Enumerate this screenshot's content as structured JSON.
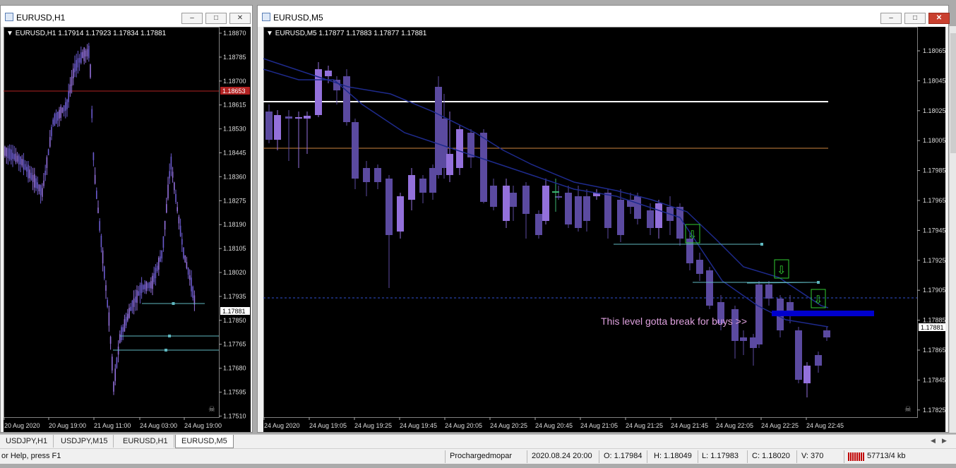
{
  "left_window": {
    "title": "EURUSD,H1",
    "info": "EURUSD,H1  1.17914 1.17923 1.17834 1.17881",
    "price_labels": [
      "1.18870",
      "1.18785",
      "1.18700",
      "1.18615",
      "1.18530",
      "1.18445",
      "1.18360",
      "1.18275",
      "1.18190",
      "1.18105",
      "1.18020",
      "1.17935",
      "1.17850",
      "1.17765",
      "1.17680",
      "1.17595",
      "1.17510"
    ],
    "red_line_label": "1.18653",
    "current_price_label": "1.17881",
    "time_labels": [
      "20 Aug 2020",
      "20 Aug 19:00",
      "21 Aug 11:00",
      "24 Aug 03:00",
      "24 Aug 19:00"
    ],
    "colors": {
      "bull": "#9370db",
      "bear": "#6a5acd",
      "red_line": "#b22222",
      "trend": "#5fb8c0"
    }
  },
  "right_window": {
    "title": "EURUSD,M5",
    "info": "EURUSD,M5  1.17877 1.17883 1.17877 1.17881",
    "price_labels": [
      "1.18065",
      "1.18045",
      "1.18025",
      "1.18005",
      "1.17985",
      "1.17965",
      "1.17945",
      "1.17925",
      "1.17905",
      "1.17885",
      "1.17865",
      "1.17845",
      "1.17825"
    ],
    "current_price_label": "1.17881",
    "time_labels": [
      "24 Aug 2020",
      "24 Aug 19:05",
      "24 Aug 19:25",
      "24 Aug 19:45",
      "24 Aug 20:05",
      "24 Aug 20:25",
      "24 Aug 20:45",
      "24 Aug 21:05",
      "24 Aug 21:25",
      "24 Aug 21:45",
      "24 Aug 22:05",
      "24 Aug 22:25",
      "24 Aug 22:45"
    ],
    "annotation": "This level gotta break for buys >>",
    "colors": {
      "bull": "#9370db",
      "bear": "#5b4aa0",
      "white_line": "#ffffff",
      "orange_line": "#cd853f",
      "ma": "#1e2a8c",
      "sell_arrow": "#32cd32",
      "zone": "#0000cd",
      "annotation": "#dda0dd"
    }
  },
  "tabs": [
    {
      "label": "USDJPY,H1"
    },
    {
      "label": "USDJPY,M15"
    },
    {
      "label": "EURUSD,H1"
    },
    {
      "label": "EURUSD,M5",
      "active": true
    }
  ],
  "status": {
    "help": "or Help, press F1",
    "profile": "Prochargedmopar",
    "datetime": "2020.08.24 20:00",
    "open": "O: 1.17984",
    "high": "H: 1.18049",
    "low": "L: 1.17983",
    "close": "C: 1.18020",
    "volume": "V: 370",
    "traffic": "57713/4 kb"
  },
  "window_buttons": {
    "minimize": "–",
    "maximize": "□",
    "close": "✕"
  }
}
